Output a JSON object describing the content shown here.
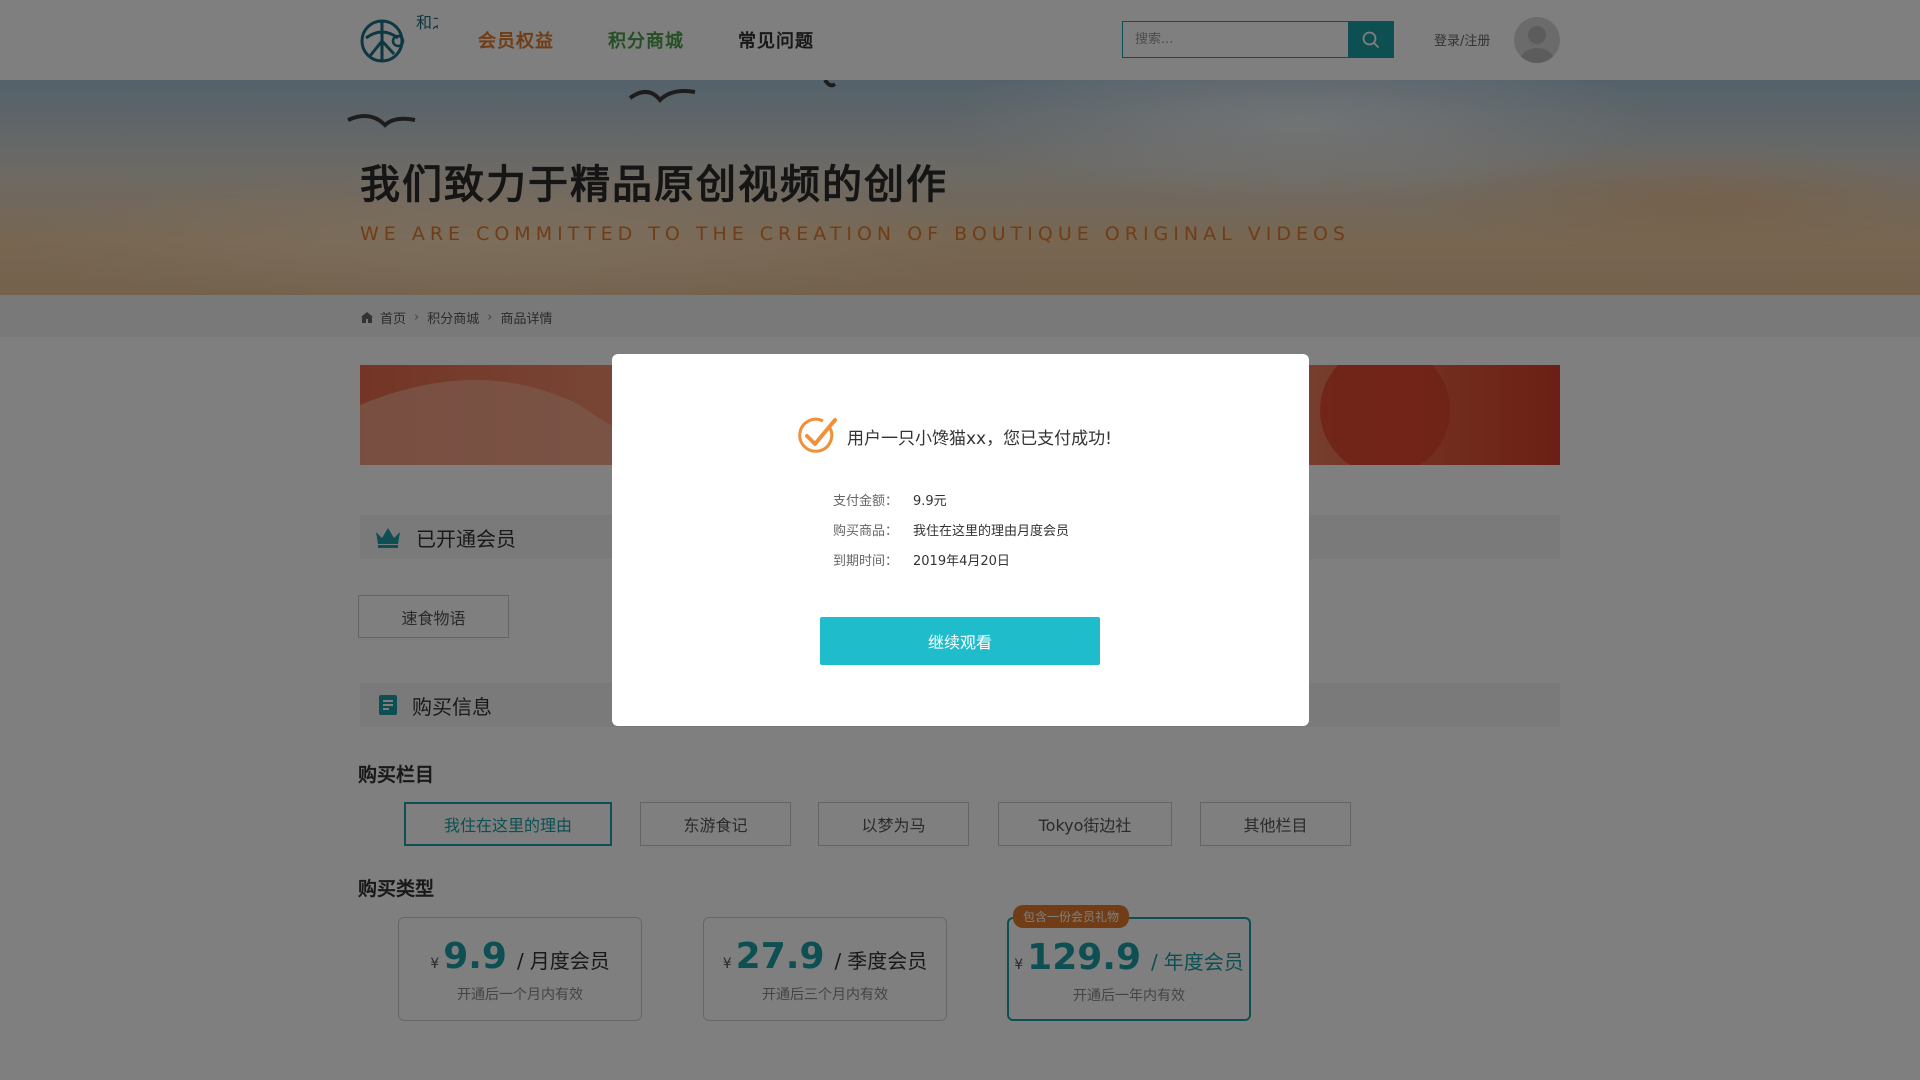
{
  "header": {
    "logo_text": "和之季",
    "nav": [
      {
        "label": "会员权益",
        "color": "#e07a2c"
      },
      {
        "label": "积分商城",
        "color": "#4aa04a"
      },
      {
        "label": "常见问题",
        "color": "#333333"
      }
    ],
    "search": {
      "placeholder": "搜索..."
    },
    "login_label": "登录/注册"
  },
  "banner": {
    "title": "我们致力于精品原创视频的创作",
    "subtitle": "WE ARE COMMITTED TO THE CREATION OF BOUTIQUE ORIGINAL VIDEOS"
  },
  "breadcrumb": [
    "首页",
    "积分商城",
    "商品详情"
  ],
  "member_section": {
    "title": "已开通会员",
    "tags": [
      "速食物语"
    ]
  },
  "purchase_section": {
    "title": "购买信息",
    "column_heading": "购买栏目",
    "columns": [
      "我住在这里的理由",
      "东游食记",
      "以梦为马",
      "Tokyo街边社",
      "其他栏目"
    ],
    "type_heading": "购买类型",
    "plans": [
      {
        "currency": "¥",
        "price": "9.9",
        "name": "月度会员",
        "desc": "开通后一个月内有效"
      },
      {
        "currency": "¥",
        "price": "27.9",
        "name": "季度会员",
        "desc": "开通后三个月内有效"
      },
      {
        "currency": "¥",
        "price": "129.9",
        "name": "年度会员",
        "desc": "开通后一年内有效",
        "badge": "包含一份会员礼物"
      }
    ]
  },
  "modal": {
    "message": "用户一只小馋猫xx，您已支付成功!",
    "rows": [
      {
        "label": "支付金额：",
        "value": "9.9元"
      },
      {
        "label": "购买商品：",
        "value": "我住在这里的理由月度会员"
      },
      {
        "label": "到期时间：",
        "value": "2019年4月20日"
      }
    ],
    "button": "继续观看"
  },
  "colors": {
    "accent": "#1a9fa5",
    "orange": "#e07a2c",
    "green": "#4aa04a",
    "button": "#1fbccc"
  }
}
